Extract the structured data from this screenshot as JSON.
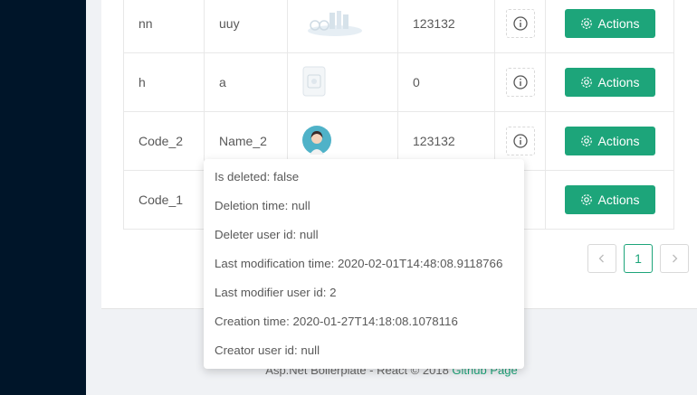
{
  "rows": [
    {
      "code": "nn",
      "name": "uuy",
      "image": "landscape-illustration",
      "value": "123132"
    },
    {
      "code": "h",
      "name": "a",
      "image": "document-thumbnail",
      "value": "0"
    },
    {
      "code": "Code_2",
      "name": "Name_2",
      "image": "avatar-woman",
      "value": "123132"
    },
    {
      "code": "Code_1",
      "name": "",
      "image": "",
      "value": ""
    }
  ],
  "action_label": "Actions",
  "pagination": {
    "current": "1"
  },
  "popover": {
    "lines": [
      "Is deleted: false",
      "Deletion time: null",
      "Deleter user id: null",
      "Last modification time: 2020-02-01T14:48:08.9118766",
      "Last modifier user id: 2",
      "Creation time: 2020-01-27T14:18:08.1078116",
      "Creator user id: null"
    ]
  },
  "footer": {
    "text": "Asp.Net Boilerplate - React © 2018 ",
    "link": "Github Page"
  },
  "colors": {
    "accent": "#1da57a",
    "sidebar": "#001529"
  }
}
